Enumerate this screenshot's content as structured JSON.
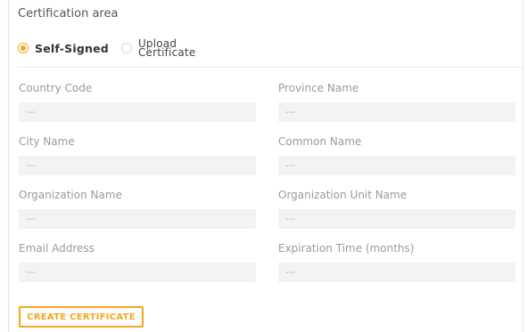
{
  "section": {
    "title": "Certification area"
  },
  "cert_type": {
    "options": [
      {
        "label": "Self-Signed",
        "selected": true
      },
      {
        "label": "Upload Certificate",
        "selected": false
      }
    ]
  },
  "fields": {
    "country_code": {
      "label": "Country Code",
      "placeholder": "---"
    },
    "province_name": {
      "label": "Province Name",
      "placeholder": "---"
    },
    "city_name": {
      "label": "City Name",
      "placeholder": "---"
    },
    "common_name": {
      "label": "Common Name",
      "placeholder": "---"
    },
    "organization_name": {
      "label": "Organization Name",
      "placeholder": "---"
    },
    "organization_unit_name": {
      "label": "Organization Unit Name",
      "placeholder": "---"
    },
    "email_address": {
      "label": "Email Address",
      "placeholder": "---"
    },
    "expiration_time": {
      "label": "Expiration Time (months)",
      "placeholder": "---"
    }
  },
  "actions": {
    "create_label": "CREATE CERTIFICATE"
  },
  "colors": {
    "accent": "#f5a623",
    "input_bg": "#f3f3f3",
    "label": "#9b9b9b"
  }
}
